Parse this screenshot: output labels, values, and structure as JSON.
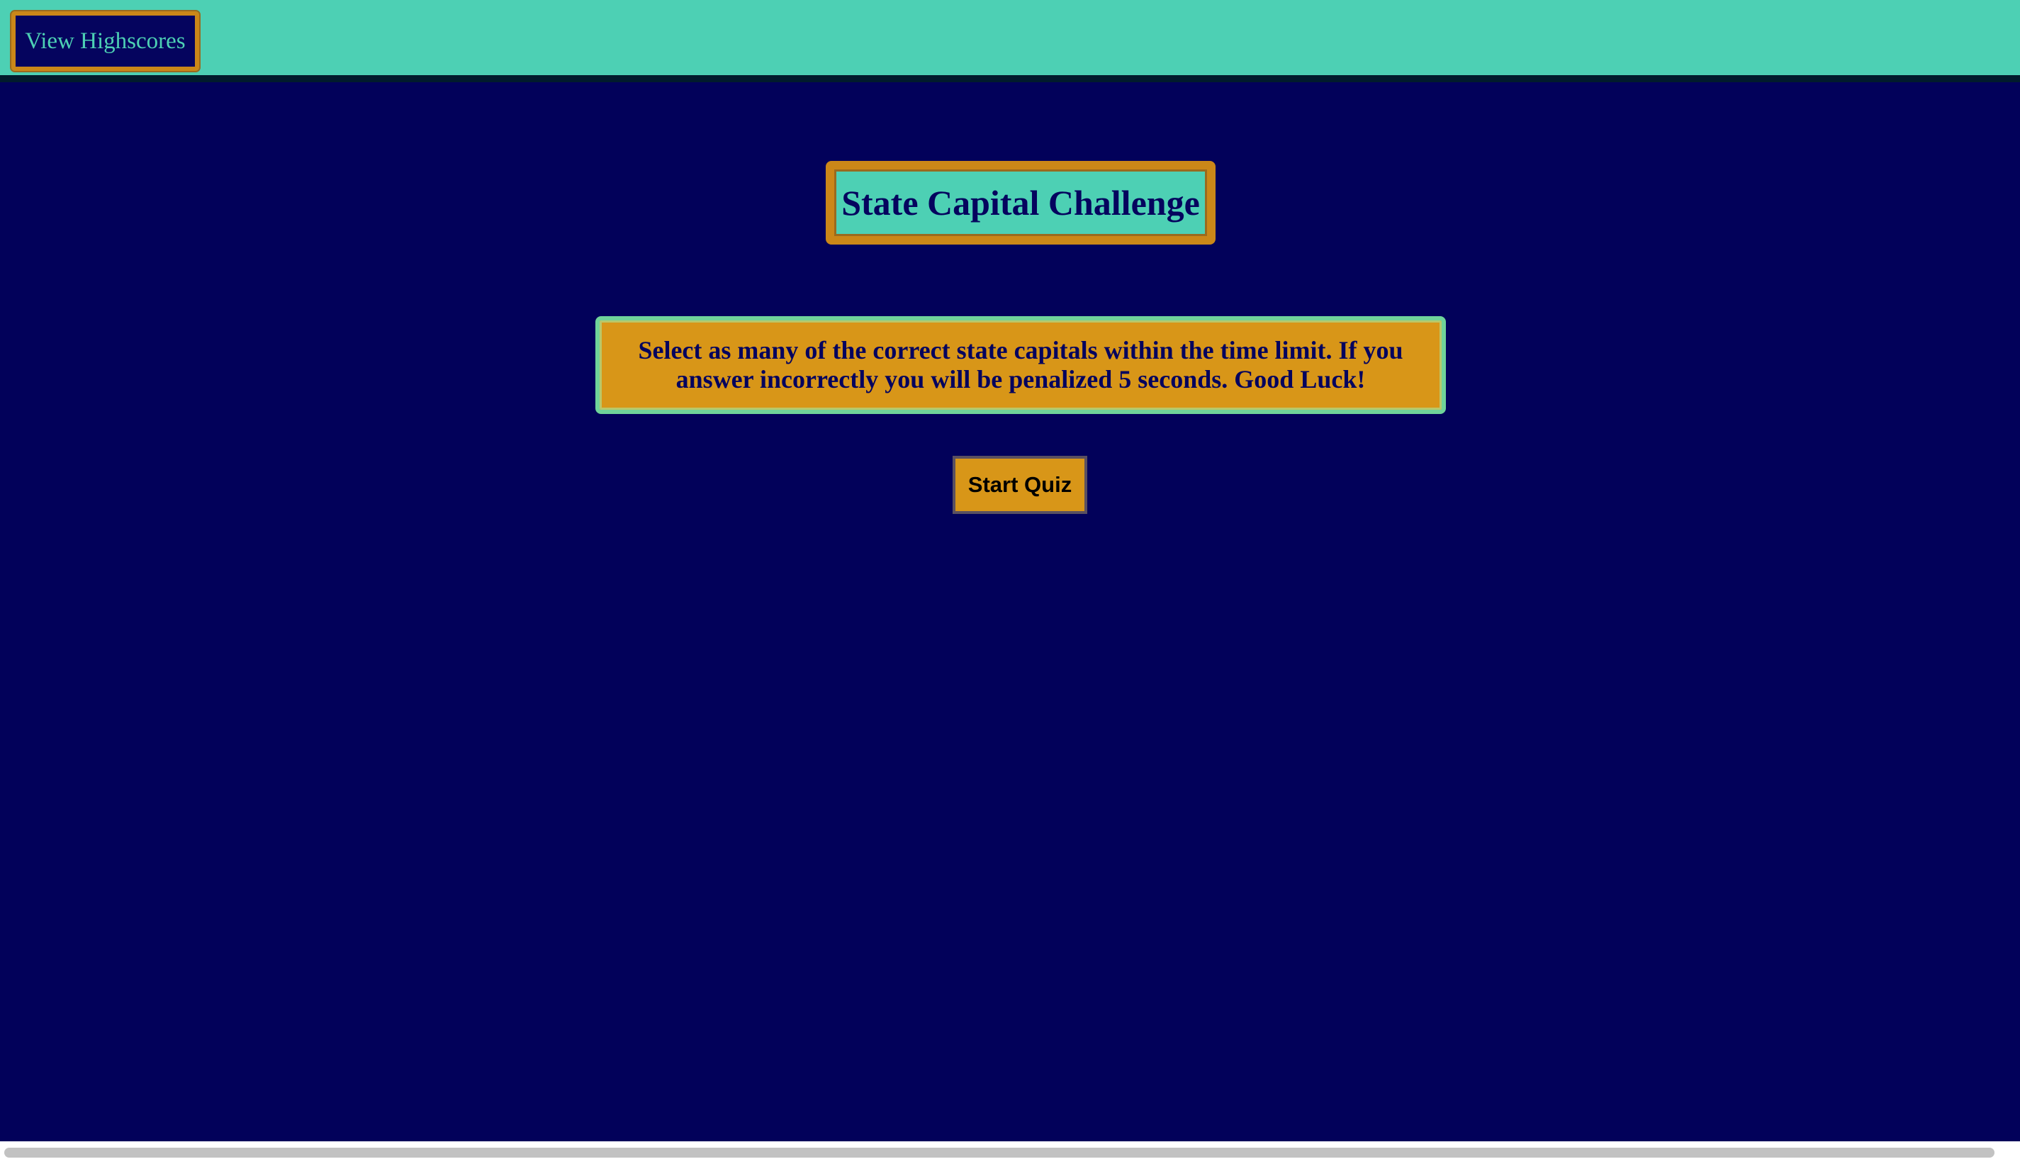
{
  "header": {
    "highscores_label": "View Highscores"
  },
  "main": {
    "title": "State Capital Challenge",
    "instructions": "Select as many of the correct state capitals within the time limit. If you answer incorrectly you will be penalized 5 seconds. Good Luck!",
    "start_label": "Start Quiz"
  },
  "colors": {
    "background": "#02015A",
    "header": "#4DD0B4",
    "accent_gold": "#CB8718",
    "instructions_fill": "#D89618",
    "instructions_border": "#6FD39A"
  }
}
